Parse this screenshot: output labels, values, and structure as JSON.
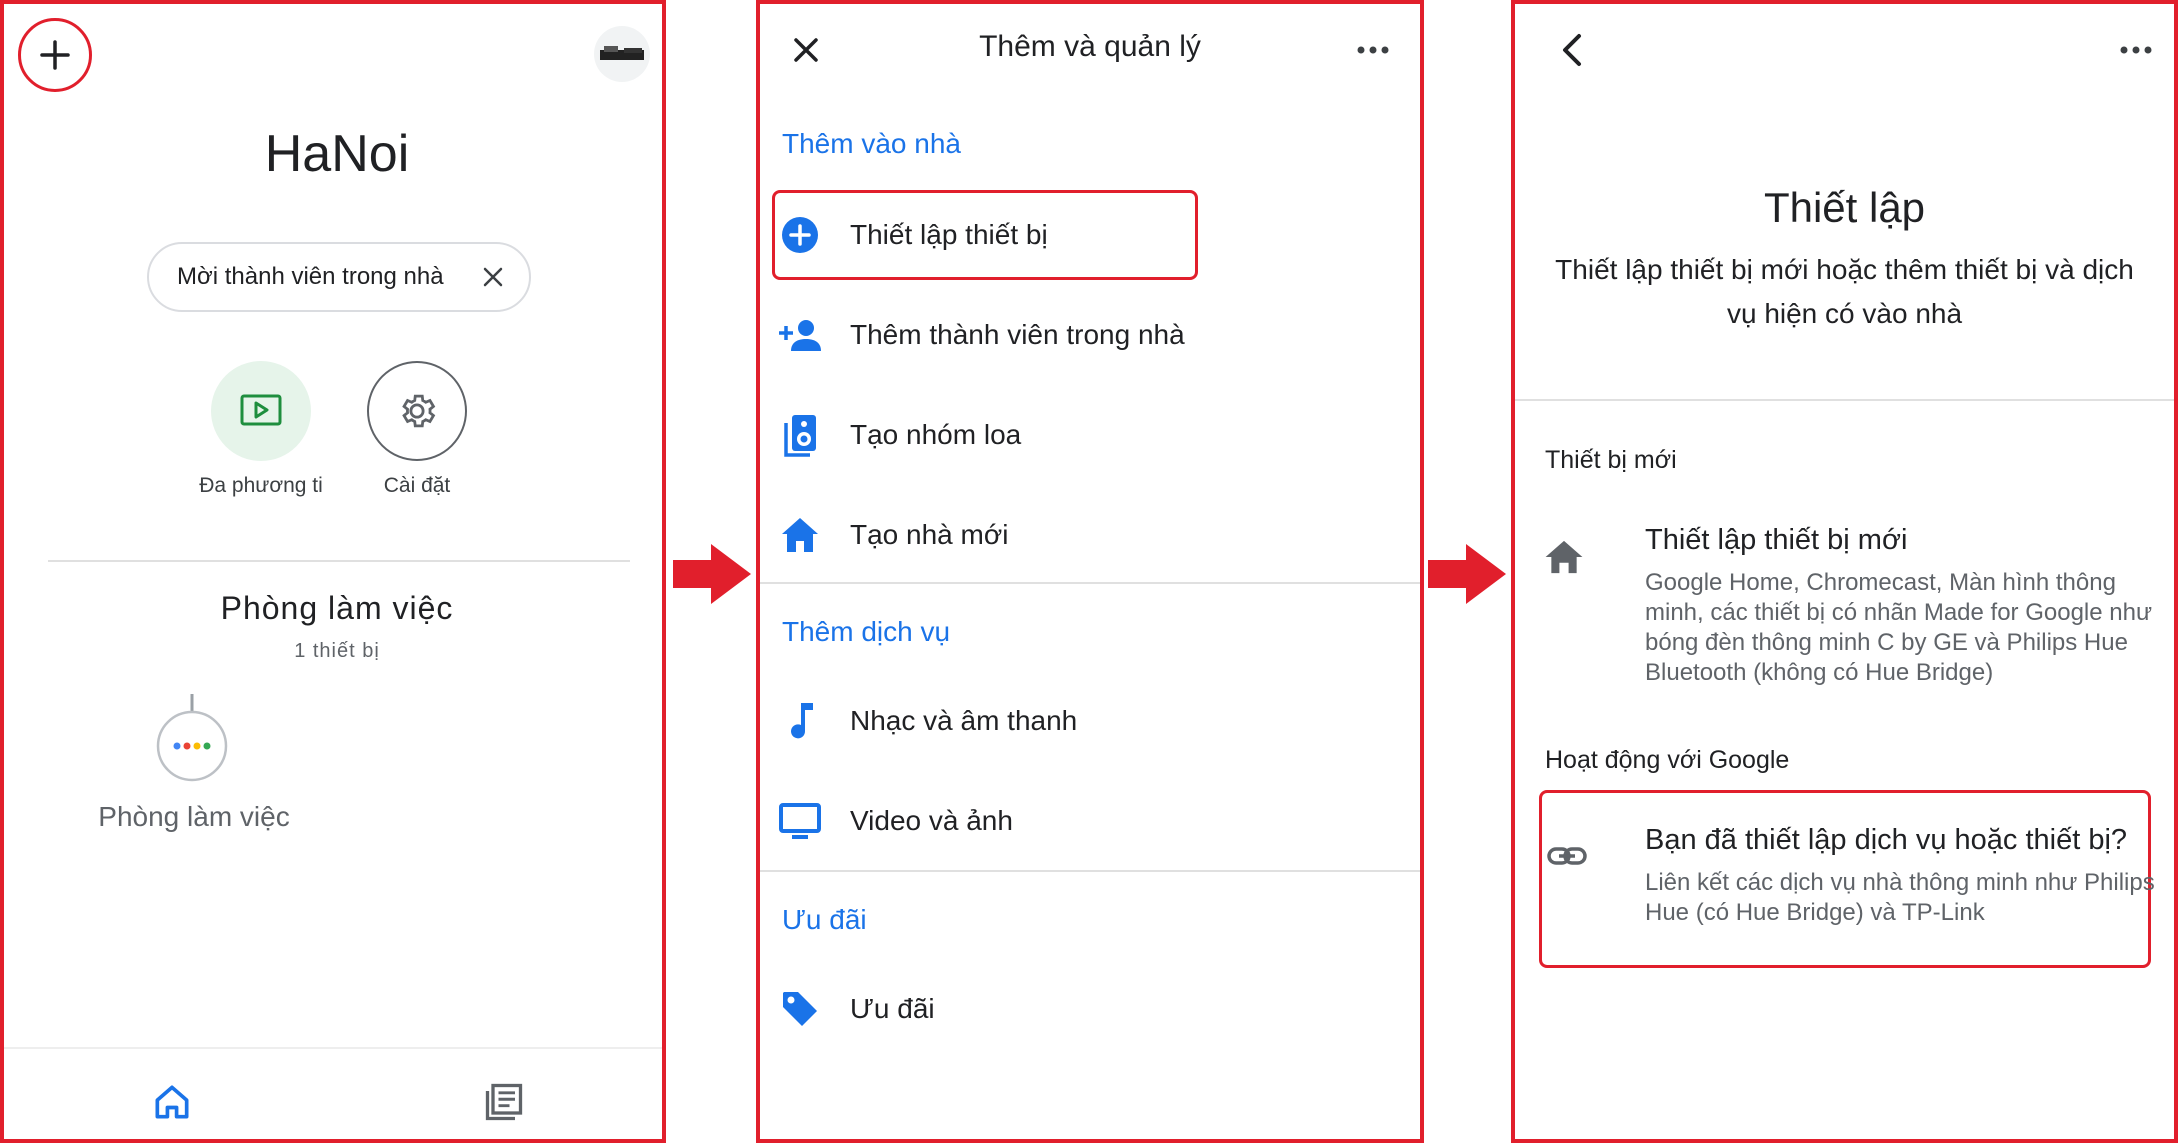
{
  "colors": {
    "highlight": "#e11f2c",
    "accent_blue": "#1a73e8",
    "media_green": "#1e8e3e"
  },
  "panel1": {
    "home_name": "HaNoi",
    "invite_chip": "Mời thành viên trong nhà",
    "media_label": "Đa phương ti",
    "settings_label": "Cài đặt",
    "room_title": "Phòng làm việc",
    "room_device_count": "1 thiết bị",
    "device_label": "Phòng làm việc"
  },
  "panel2": {
    "title": "Thêm và quản lý",
    "section_add_home": "Thêm vào nhà",
    "item_setup_device": "Thiết lập thiết bị",
    "item_add_member": "Thêm thành viên trong nhà",
    "item_speaker_group": "Tạo nhóm loa",
    "item_new_home": "Tạo nhà mới",
    "section_services": "Thêm dịch vụ",
    "item_music": "Nhạc và âm thanh",
    "item_video": "Video và ảnh",
    "section_offers": "Ưu đãi",
    "item_offers": "Ưu đãi"
  },
  "panel3": {
    "title": "Thiết lập",
    "subtitle": "Thiết lập thiết bị mới hoặc thêm thiết bị và dịch vụ hiện có vào nhà",
    "section_new": "Thiết bị mới",
    "new_device_title": "Thiết lập thiết bị mới",
    "new_device_desc": "Google Home, Chromecast, Màn hình thông minh, các thiết bị có nhãn Made for Google như bóng đèn thông minh C by GE và Philips Hue Bluetooth (không có Hue Bridge)",
    "section_works": "Hoạt động với Google",
    "existing_title": "Bạn đã thiết lập dịch vụ hoặc thiết bị?",
    "existing_desc": "Liên kết các dịch vụ nhà thông minh như Philips Hue (có Hue Bridge) và TP-Link"
  }
}
